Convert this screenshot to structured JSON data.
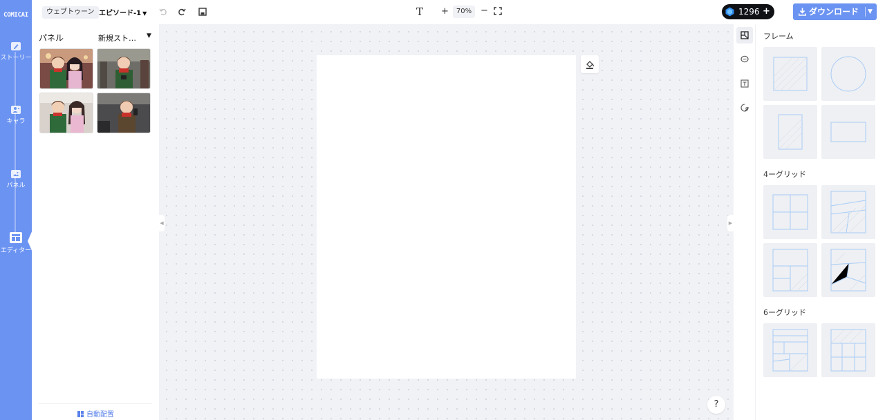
{
  "app": {
    "logo": "COMICAI"
  },
  "rail": {
    "items": [
      {
        "label": "ストーリー",
        "icon": "pencil-icon"
      },
      {
        "label": "キャラ",
        "icon": "person-icon"
      },
      {
        "label": "パネル",
        "icon": "image-icon"
      },
      {
        "label": "エディター",
        "icon": "layout-icon"
      }
    ],
    "active": "エディター"
  },
  "header": {
    "format_chip": "ウェブトゥーン",
    "episode": "エピソード-1",
    "zoom_label": "70%",
    "text_tool": "T",
    "zoom_in": "+",
    "zoom_out": "−",
    "credits": "1296",
    "credits_add": "+",
    "download_label": "ダウンロード"
  },
  "left_panel": {
    "title": "パネル",
    "story_select": "新規スト…",
    "thumbnails": [
      {
        "name": "panel-thumb-1",
        "description": "boy and girl with phones"
      },
      {
        "name": "panel-thumb-2",
        "description": "boy with phone in hallway"
      },
      {
        "name": "panel-thumb-3",
        "description": "boy and girl smiling"
      },
      {
        "name": "panel-thumb-4",
        "description": "boy holding phone"
      }
    ],
    "auto_layout": "自動配置"
  },
  "canvas": {
    "help": "?"
  },
  "right_panel": {
    "sections": [
      {
        "title": "フレーム"
      },
      {
        "title": "4ーグリッド"
      },
      {
        "title": "6ーグリッド"
      }
    ]
  },
  "colors": {
    "accent": "#6b93f2",
    "canvas_bg": "#f1f2f6",
    "tile_bg": "#eef0f4",
    "frame_line": "#a9ccf5",
    "credits_bg": "#0f1115"
  }
}
